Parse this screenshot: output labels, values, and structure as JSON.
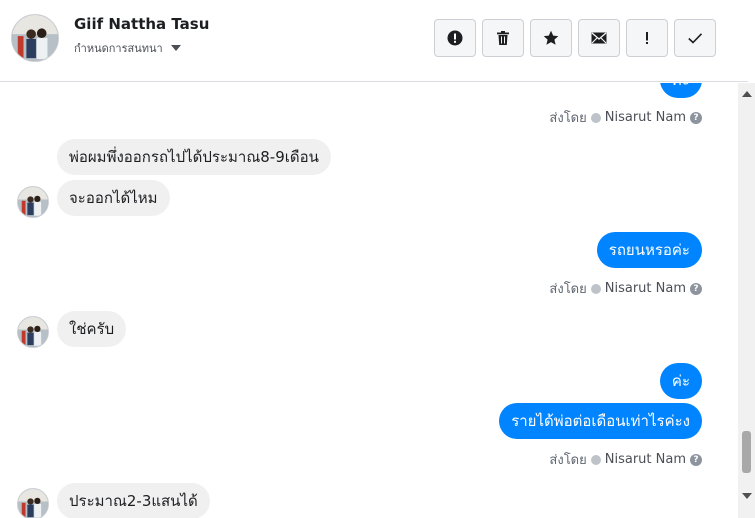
{
  "header": {
    "contact_name": "Giif Nattha Tasu",
    "subtitle": "กำหนดการสนทนา",
    "actions": [
      {
        "icon": "alert-circle-icon",
        "name": "mark-spam-button"
      },
      {
        "icon": "trash-icon",
        "name": "delete-button"
      },
      {
        "icon": "star-icon",
        "name": "star-button"
      },
      {
        "icon": "envelope-icon",
        "name": "mark-unread-button"
      },
      {
        "icon": "exclamation-icon",
        "name": "follow-up-button"
      },
      {
        "icon": "checkmark-icon",
        "name": "mark-done-button"
      }
    ]
  },
  "messages": {
    "m0": "ค่ะ",
    "m1": "พ่อผมพึ่งออกรถไปได้ประมาณ8-9เดือน",
    "m2": "จะออกได้ไหม",
    "m3": "รถยนหรอค่ะ",
    "m4": "ใช่ครับ",
    "m5": "ค่ะ",
    "m6": "รายได้พ่อต่อเดือนเท่าไรค่ะง",
    "m7": "ประมาณ2-3แสนได้"
  },
  "seen": {
    "prefix": "ส่งโดย",
    "sender": "Nisarut Nam",
    "help": "?"
  },
  "colors": {
    "outgoing_bubble": "#0084ff",
    "incoming_bubble": "#f1f0f0"
  }
}
